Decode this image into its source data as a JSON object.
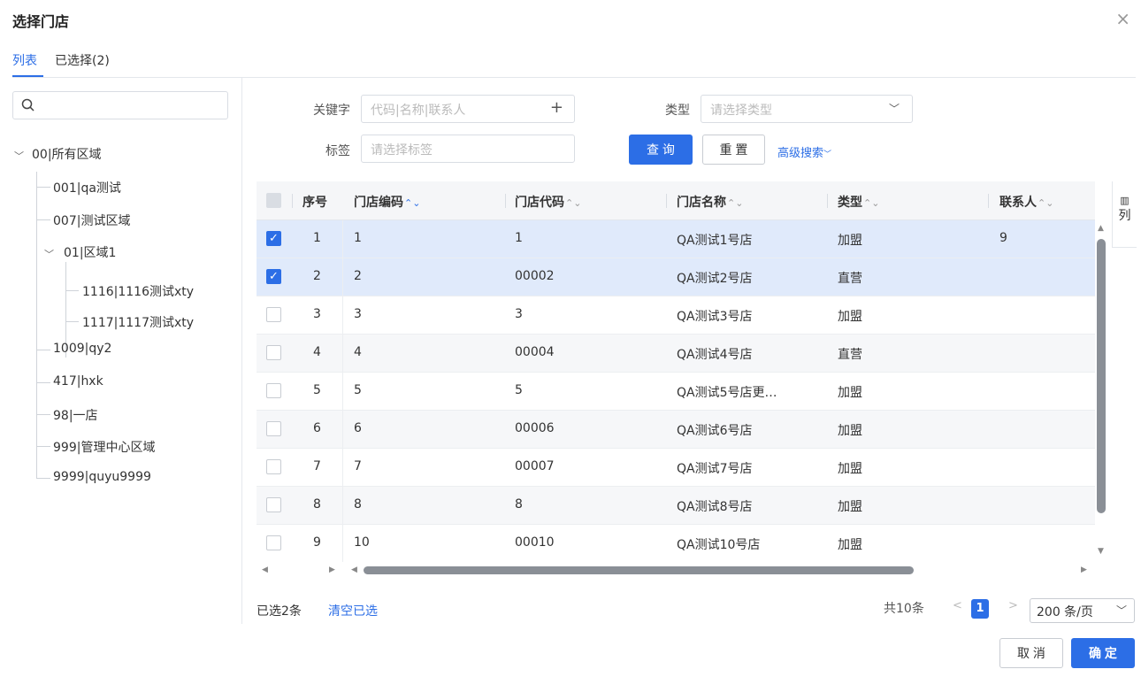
{
  "dialog": {
    "title": "选择门店",
    "close": "×"
  },
  "tabs": [
    {
      "label": "列表"
    },
    {
      "label": "已选择(2)"
    }
  ],
  "tree": {
    "nodes": [
      {
        "label": "00|所有区域"
      },
      {
        "label": "001|qa测试"
      },
      {
        "label": "007|测试区域"
      },
      {
        "label": "01|区域1"
      },
      {
        "label": "1116|1116测试xty"
      },
      {
        "label": "1117|1117测试xty"
      },
      {
        "label": "1009|qy2"
      },
      {
        "label": "417|hxk"
      },
      {
        "label": "98|一店"
      },
      {
        "label": "999|管理中心区域"
      },
      {
        "label": "9999|quyu9999"
      }
    ]
  },
  "filters": {
    "keyword_label": "关键字",
    "keyword_placeholder": "代码|名称|联系人",
    "type_label": "类型",
    "type_placeholder": "请选择类型",
    "tag_label": "标签",
    "tag_placeholder": "请选择标签",
    "search_btn": "查 询",
    "reset_btn": "重 置",
    "advanced": "高级搜索"
  },
  "table": {
    "columns": [
      "序号",
      "门店编码",
      "门店代码",
      "门店名称",
      "类型",
      "联系人"
    ],
    "rows": [
      {
        "idx": "1",
        "code": "1",
        "daima": "1",
        "name": "QA测试1号店",
        "type": "加盟",
        "contact": "9",
        "checked": true
      },
      {
        "idx": "2",
        "code": "2",
        "daima": "00002",
        "name": "QA测试2号店",
        "type": "直营",
        "contact": "",
        "checked": true
      },
      {
        "idx": "3",
        "code": "3",
        "daima": "3",
        "name": "QA测试3号店",
        "type": "加盟",
        "contact": "",
        "checked": false
      },
      {
        "idx": "4",
        "code": "4",
        "daima": "00004",
        "name": "QA测试4号店",
        "type": "直营",
        "contact": "",
        "checked": false
      },
      {
        "idx": "5",
        "code": "5",
        "daima": "5",
        "name": "QA测试5号店更…",
        "type": "加盟",
        "contact": "",
        "checked": false
      },
      {
        "idx": "6",
        "code": "6",
        "daima": "00006",
        "name": "QA测试6号店",
        "type": "加盟",
        "contact": "",
        "checked": false
      },
      {
        "idx": "7",
        "code": "7",
        "daima": "00007",
        "name": "QA测试7号店",
        "type": "加盟",
        "contact": "",
        "checked": false
      },
      {
        "idx": "8",
        "code": "8",
        "daima": "8",
        "name": "QA测试8号店",
        "type": "加盟",
        "contact": "",
        "checked": false
      },
      {
        "idx": "9",
        "code": "10",
        "daima": "00010",
        "name": "QA测试10号店",
        "type": "加盟",
        "contact": "",
        "checked": false
      }
    ],
    "col_settings": "列"
  },
  "footer": {
    "selected": "已选2条",
    "clear": "清空已选",
    "total": "共10条",
    "page": "1",
    "page_size": "200 条/页",
    "cancel": "取 消",
    "ok": "确 定"
  },
  "colors": {
    "accent": "#2c6ee6",
    "selected_row": "#e0eafb"
  }
}
